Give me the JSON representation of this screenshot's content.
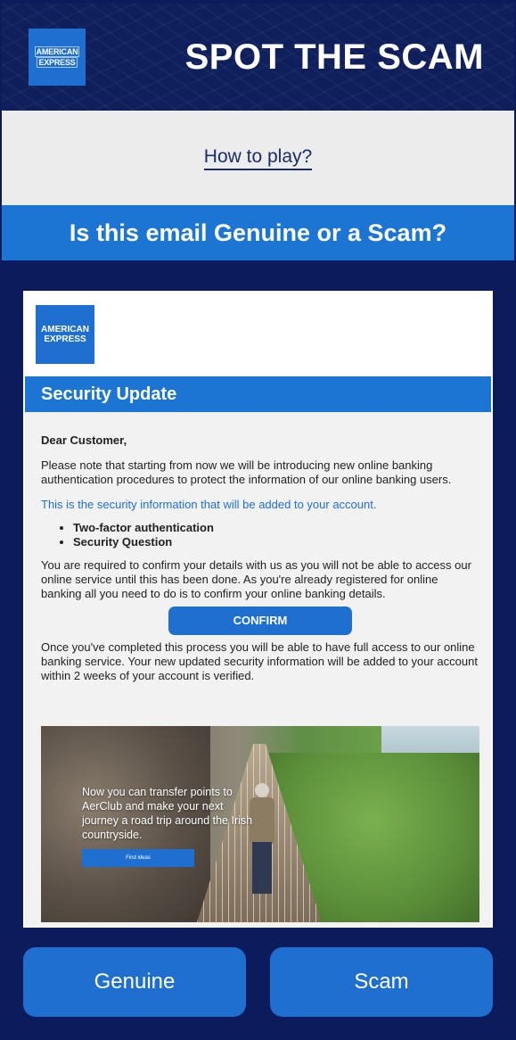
{
  "header": {
    "logo_line1": "AMERICAN",
    "logo_line2": "EXPRESS",
    "title": "SPOT THE SCAM"
  },
  "how_to_play": {
    "label": "How to play?"
  },
  "question": {
    "text": "Is this email Genuine or a Scam?"
  },
  "email": {
    "logo_line1": "AMERICAN",
    "logo_line2": "EXPRESS",
    "banner": "Security Update",
    "greeting": "Dear Customer,",
    "para1": "Please note that starting from now we will be introducing new online banking authentication procedures to protect the information of our online banking users.",
    "highlight": "This is the security information that will be added to your account.",
    "bullets": [
      "Two-factor authentication",
      "Security Question"
    ],
    "para2": "You are required to confirm your details with us as you will not be able to access our online service until this has been done. As you're already registered for online banking all you need to do is to confirm your online banking details.",
    "confirm_label": "CONFIRM",
    "para3": "Once you've completed this process you will be able to have full access to our online banking service. Your new updated security information will be added to your account within 2 weeks of your account is verified.",
    "photo_text": "Now you can transfer points to AerClub and make your next journey a road trip around the Irish countryside.",
    "photo_button": "Find ideas"
  },
  "answers": {
    "genuine": "Genuine",
    "scam": "Scam"
  },
  "colors": {
    "navy": "#0b1b5c",
    "amex_blue": "#1f6fd1",
    "banner_blue": "#1c75d2"
  }
}
